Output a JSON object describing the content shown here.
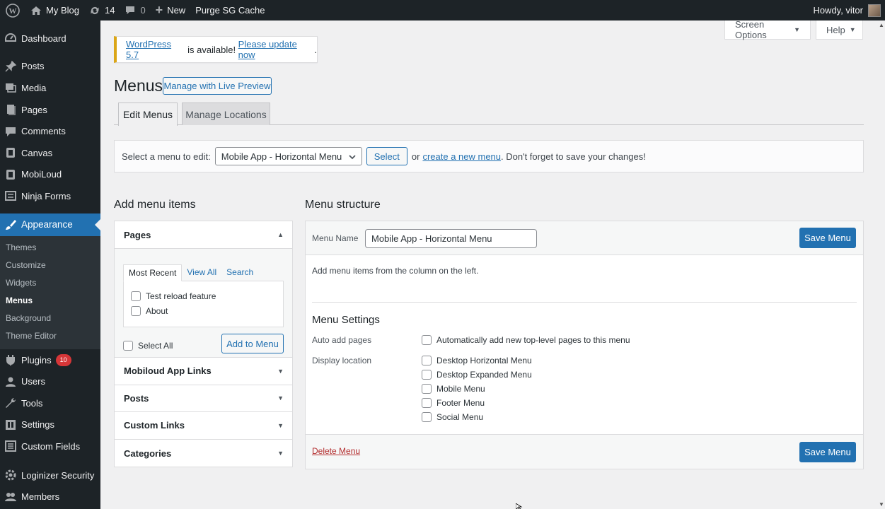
{
  "adminbar": {
    "site_name": "My Blog",
    "updates_count": "14",
    "comments_count": "0",
    "new_label": "New",
    "purge_label": "Purge SG Cache",
    "howdy": "Howdy, vitor"
  },
  "sidebar": {
    "items": [
      {
        "label": "Dashboard",
        "icon": "dashboard-icon"
      },
      {
        "label": "Posts",
        "icon": "pin-icon"
      },
      {
        "label": "Media",
        "icon": "media-icon"
      },
      {
        "label": "Pages",
        "icon": "pages-icon"
      },
      {
        "label": "Comments",
        "icon": "comment-icon"
      },
      {
        "label": "Canvas",
        "icon": "canvas-icon"
      },
      {
        "label": "MobiLoud",
        "icon": "mobiloud-icon"
      },
      {
        "label": "Ninja Forms",
        "icon": "forms-icon"
      },
      {
        "label": "Appearance",
        "icon": "brush-icon"
      }
    ],
    "appearance_sub": [
      "Themes",
      "Customize",
      "Widgets",
      "Menus",
      "Background",
      "Theme Editor"
    ],
    "items_after": [
      {
        "label": "Plugins",
        "icon": "plugin-icon",
        "badge": "10"
      },
      {
        "label": "Users",
        "icon": "users-icon"
      },
      {
        "label": "Tools",
        "icon": "tools-icon"
      },
      {
        "label": "Settings",
        "icon": "settings-icon"
      },
      {
        "label": "Custom Fields",
        "icon": "fields-icon"
      },
      {
        "label": "Loginizer Security",
        "icon": "gear-icon"
      },
      {
        "label": "Members",
        "icon": "members-icon"
      }
    ]
  },
  "screen_options": "Screen Options",
  "help": "Help",
  "notice": {
    "version_link": "WordPress 5.7",
    "middle": " is available! ",
    "update_link": "Please update now",
    "end": "."
  },
  "page": {
    "title": "Menus",
    "live_preview": "Manage with Live Preview",
    "tabs": [
      "Edit Menus",
      "Manage Locations"
    ]
  },
  "manage": {
    "label": "Select a menu to edit:",
    "selected_menu": "Mobile App - Horizontal Menu",
    "select_btn": "Select",
    "or": "or",
    "create_link": "create a new menu",
    "after": ". Don't forget to save your changes!"
  },
  "add_items": {
    "heading": "Add menu items",
    "pages_title": "Pages",
    "inner_tabs": [
      "Most Recent",
      "View All",
      "Search"
    ],
    "pages": [
      "Test reload feature",
      "About"
    ],
    "select_all": "Select All",
    "add_btn": "Add to Menu",
    "sections": [
      "Mobiloud App Links",
      "Posts",
      "Custom Links",
      "Categories"
    ]
  },
  "structure": {
    "heading": "Menu structure",
    "menu_name_label": "Menu Name",
    "menu_name_value": "Mobile App - Horizontal Menu",
    "save_btn": "Save Menu",
    "hint": "Add menu items from the column on the left.",
    "settings_heading": "Menu Settings",
    "auto_add_label": "Auto add pages",
    "auto_add_option": "Automatically add new top-level pages to this menu",
    "display_location_label": "Display location",
    "locations": [
      "Desktop Horizontal Menu",
      "Desktop Expanded Menu",
      "Mobile Menu",
      "Footer Menu",
      "Social Menu"
    ],
    "delete_link": "Delete Menu"
  },
  "colors": {
    "accent": "#2271b1",
    "admin_bar": "#1d2327",
    "notice_border": "#dba617",
    "delete": "#b32d2e"
  }
}
